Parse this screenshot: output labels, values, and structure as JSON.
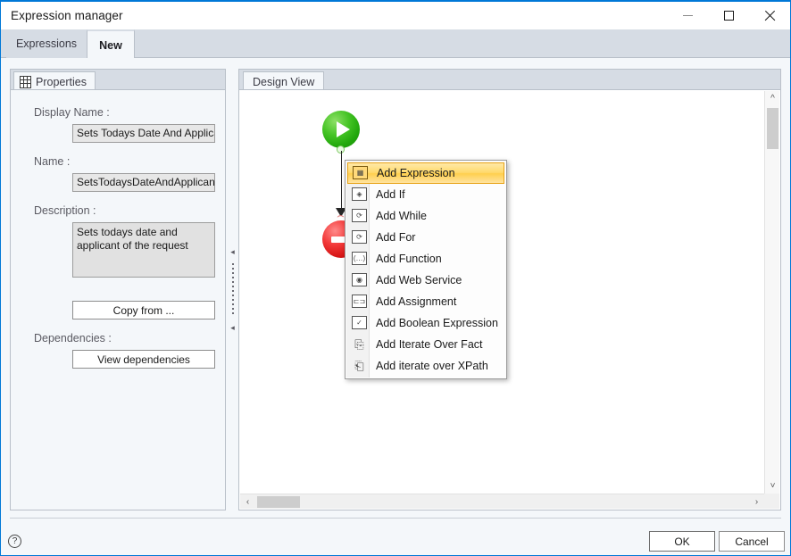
{
  "window": {
    "title": "Expression manager",
    "controls": {
      "minimize": "minimize-button",
      "maximize": "maximize-button",
      "close": "close-button"
    }
  },
  "tabs": [
    {
      "label": "Expressions",
      "active": false
    },
    {
      "label": "New",
      "active": true
    }
  ],
  "properties_panel": {
    "tab_label": "Properties",
    "fields": {
      "display_name_label": "Display Name :",
      "display_name_value": "Sets Todays Date And Applican",
      "name_label": "Name :",
      "name_value": "SetsTodaysDateAndApplicant",
      "description_label": "Description :",
      "description_value": "Sets todays date and applicant of the request",
      "dependencies_label": "Dependencies :"
    },
    "buttons": {
      "copy_from": "Copy from ...",
      "view_dependencies": "View dependencies"
    }
  },
  "design_panel": {
    "tab_label": "Design View",
    "nodes": [
      {
        "name": "start-node",
        "type": "start",
        "glyph": "play"
      },
      {
        "name": "stop-node",
        "type": "stop",
        "glyph": "stop-bar"
      }
    ]
  },
  "context_menu": {
    "highlight_color": "#ffd96b",
    "highlight_border": "#e8a317",
    "items": [
      {
        "label": "Add Expression",
        "icon": "expression-icon",
        "highlighted": true
      },
      {
        "label": "Add If",
        "icon": "if-icon",
        "highlighted": false
      },
      {
        "label": "Add While",
        "icon": "while-icon",
        "highlighted": false
      },
      {
        "label": "Add For",
        "icon": "for-icon",
        "highlighted": false
      },
      {
        "label": "Add Function",
        "icon": "function-icon",
        "highlighted": false
      },
      {
        "label": "Add Web Service",
        "icon": "web-service-icon",
        "highlighted": false
      },
      {
        "label": "Add Assignment",
        "icon": "assignment-icon",
        "highlighted": false
      },
      {
        "label": "Add Boolean Expression",
        "icon": "boolean-icon",
        "highlighted": false
      },
      {
        "label": "Add Iterate Over Fact",
        "icon": "iterate-fact-icon",
        "highlighted": false
      },
      {
        "label": "Add iterate over XPath",
        "icon": "iterate-xpath-icon",
        "highlighted": false
      }
    ]
  },
  "footer": {
    "help": "?",
    "ok": "OK",
    "cancel": "Cancel"
  }
}
